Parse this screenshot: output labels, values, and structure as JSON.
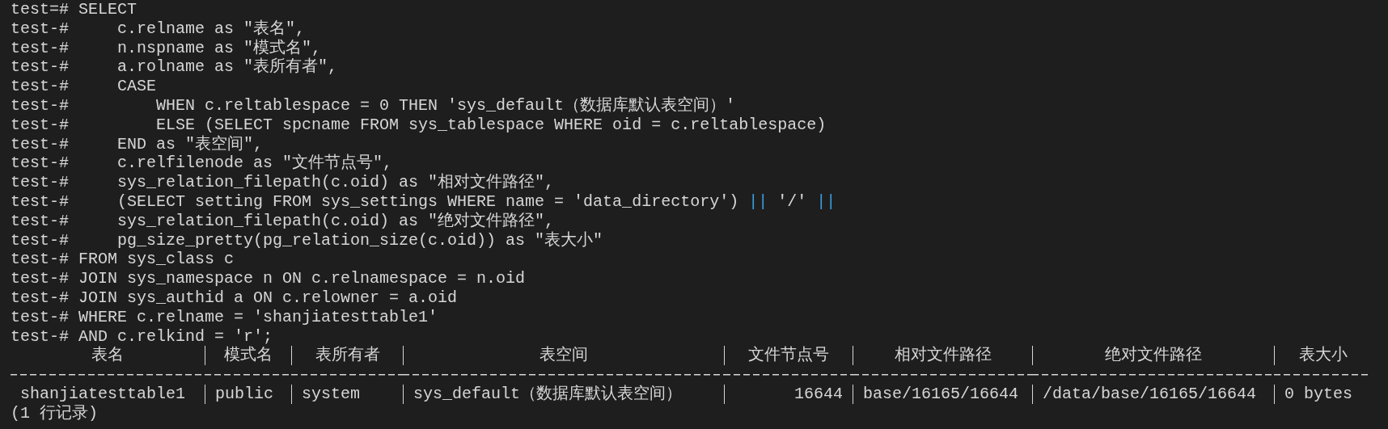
{
  "lines": [
    {
      "kind": "plain",
      "text": "test=# SELECT"
    },
    {
      "kind": "plain",
      "text": "test-#     c.relname as \"表名\","
    },
    {
      "kind": "plain",
      "text": "test-#     n.nspname as \"模式名\","
    },
    {
      "kind": "plain",
      "text": "test-#     a.rolname as \"表所有者\","
    },
    {
      "kind": "plain",
      "text": "test-#     CASE"
    },
    {
      "kind": "plain",
      "text": "test-#         WHEN c.reltablespace = 0 THEN 'sys_default（数据库默认表空间）'"
    },
    {
      "kind": "plain",
      "text": "test-#         ELSE (SELECT spcname FROM sys_tablespace WHERE oid = c.reltablespace)"
    },
    {
      "kind": "plain",
      "text": "test-#     END as \"表空间\","
    },
    {
      "kind": "plain",
      "text": "test-#     c.relfilenode as \"文件节点号\","
    },
    {
      "kind": "plain",
      "text": "test-#     sys_relation_filepath(c.oid) as \"相对文件路径\","
    },
    {
      "kind": "segments",
      "parts": [
        {
          "kind": "plain",
          "text": "test-#     (SELECT setting FROM sys_settings WHERE name = 'data_directory') "
        },
        {
          "kind": "operator",
          "text": "||"
        },
        {
          "kind": "plain",
          "text": " '/' "
        },
        {
          "kind": "operator",
          "text": "||"
        }
      ]
    },
    {
      "kind": "plain",
      "text": "test-#     sys_relation_filepath(c.oid) as \"绝对文件路径\","
    },
    {
      "kind": "plain",
      "text": "test-#     pg_size_pretty(pg_relation_size(c.oid)) as \"表大小\""
    },
    {
      "kind": "plain",
      "text": "test-# FROM sys_class c"
    },
    {
      "kind": "plain",
      "text": "test-# JOIN sys_namespace n ON c.relnamespace = n.oid"
    },
    {
      "kind": "plain",
      "text": "test-# JOIN sys_authid a ON c.relowner = a.oid"
    },
    {
      "kind": "plain",
      "text": "test-# WHERE c.relname = 'shanjiatesttable1'"
    },
    {
      "kind": "plain",
      "text": "test-# AND c.relkind = 'r';"
    }
  ],
  "result": {
    "columns": [
      {
        "label": "表名",
        "kind": "text"
      },
      {
        "label": "模式名",
        "kind": "text"
      },
      {
        "label": "表所有者",
        "kind": "text"
      },
      {
        "label": "表空间",
        "kind": "text"
      },
      {
        "label": "文件节点号",
        "kind": "number"
      },
      {
        "label": "相对文件路径",
        "kind": "text"
      },
      {
        "label": "绝对文件路径",
        "kind": "text"
      },
      {
        "label": "表大小",
        "kind": "text"
      }
    ],
    "rows": [
      [
        "shanjiatesttable1",
        "public",
        "system",
        "sys_default（数据库默认表空间）",
        "16644",
        "base/16165/16644",
        "/data/base/16165/16644",
        "0 bytes"
      ]
    ],
    "footer": "(1 行记录)"
  }
}
